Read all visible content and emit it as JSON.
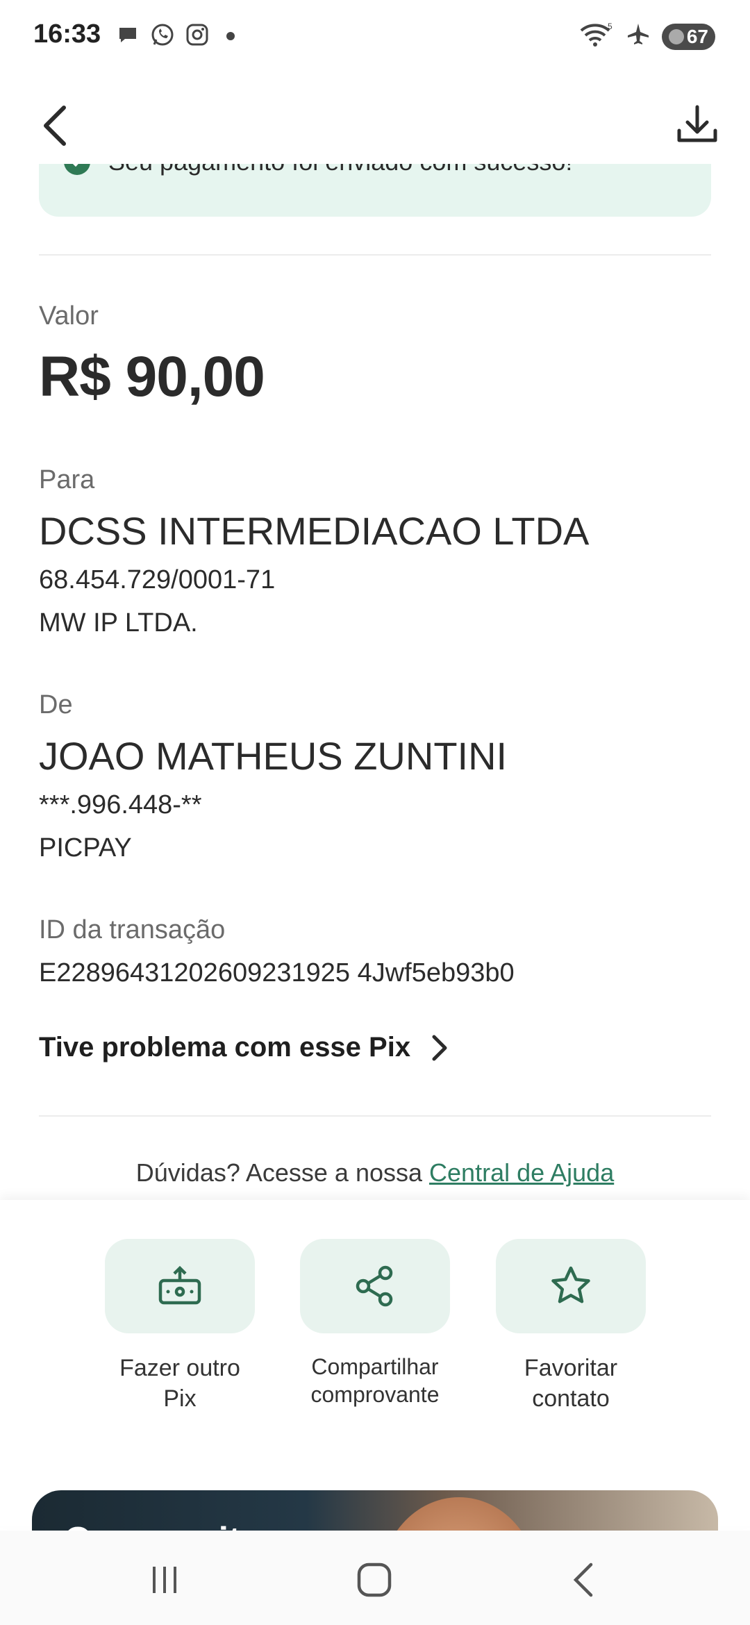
{
  "status_bar": {
    "time": "16:33",
    "left_icons": [
      "chat-bubble-icon",
      "whatsapp-icon",
      "instagram-icon",
      "notification-dot-icon"
    ],
    "battery_level": "67"
  },
  "header": {
    "back_icon": "chevron-left-icon",
    "download_icon": "download-icon"
  },
  "banner": {
    "text": "Seu pagamento foi enviado com sucesso!",
    "color": "#e6f5ef"
  },
  "valor": {
    "label": "Valor",
    "amount": "R$ 90,00"
  },
  "para": {
    "label": "Para",
    "name": "DCSS INTERMEDIACAO LTDA",
    "document": "68.454.729/0001-71",
    "institution": "MW IP LTDA."
  },
  "de": {
    "label": "De",
    "name": "JOAO MATHEUS ZUNTINI",
    "document": "***.996.448-**",
    "institution": "PICPAY"
  },
  "transaction": {
    "label": "ID da transação",
    "id": "E22896431202609231925 4Jwf5eb93b0"
  },
  "problem_link": {
    "label": "Tive problema com esse Pix"
  },
  "help": {
    "prefix": "Dúvidas? Acesse a nossa ",
    "link": "Central de Ajuda"
  },
  "actions": [
    {
      "line1": "Fazer outro",
      "line2": "Pix",
      "icon": "send-money-icon"
    },
    {
      "line1": "Compartilhar",
      "line2": "comprovante",
      "icon": "share-icon"
    },
    {
      "line1": "Favoritar",
      "line2": "contato",
      "icon": "star-icon"
    }
  ],
  "promo": {
    "text": "Quer aceitar"
  },
  "colors": {
    "accent": "#2e7d62",
    "action_bg": "#e8f3ee"
  }
}
